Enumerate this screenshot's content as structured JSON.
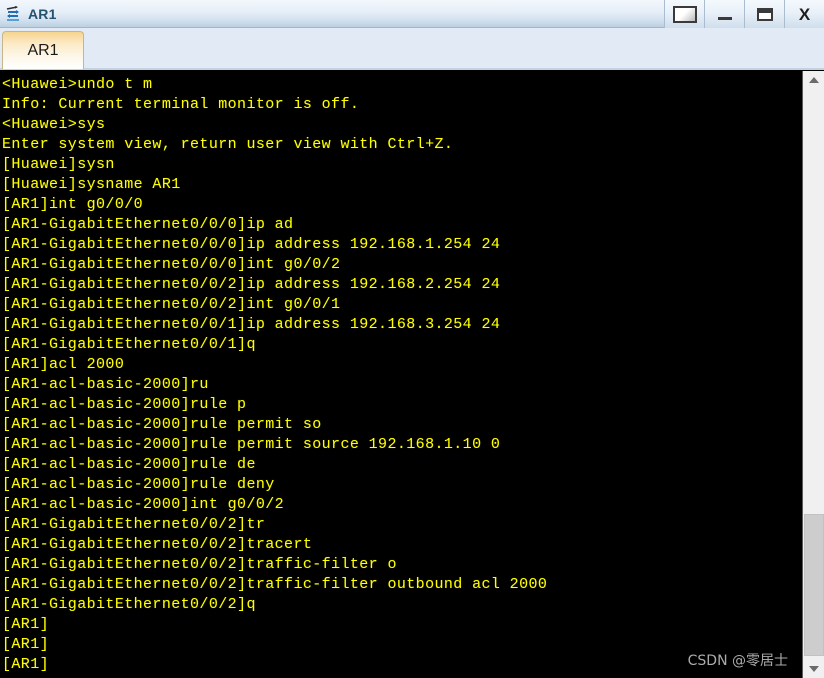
{
  "window": {
    "title": "AR1",
    "icon": "router-icon",
    "buttons": [
      {
        "name": "restore-button",
        "label": "Restore",
        "glyph": "restore-icon"
      },
      {
        "name": "minimize-button",
        "label": "Minimize",
        "glyph": "minimize-icon"
      },
      {
        "name": "maximize-button",
        "label": "Maximize",
        "glyph": "maximize-icon"
      },
      {
        "name": "close-button",
        "label": "X",
        "glyph": "close-icon"
      }
    ]
  },
  "tabs": [
    {
      "label": "AR1",
      "active": true
    }
  ],
  "terminal": {
    "background_color": "#000000",
    "text_color": "#ffff00",
    "lines": [
      "<Huawei>undo t m",
      "Info: Current terminal monitor is off.",
      "<Huawei>sys",
      "Enter system view, return user view with Ctrl+Z.",
      "[Huawei]sysn",
      "[Huawei]sysname AR1",
      "[AR1]int g0/0/0",
      "[AR1-GigabitEthernet0/0/0]ip ad",
      "[AR1-GigabitEthernet0/0/0]ip address 192.168.1.254 24",
      "[AR1-GigabitEthernet0/0/0]int g0/0/2",
      "[AR1-GigabitEthernet0/0/2]ip address 192.168.2.254 24",
      "[AR1-GigabitEthernet0/0/2]int g0/0/1",
      "[AR1-GigabitEthernet0/0/1]ip address 192.168.3.254 24",
      "[AR1-GigabitEthernet0/0/1]q",
      "[AR1]acl 2000",
      "[AR1-acl-basic-2000]ru",
      "[AR1-acl-basic-2000]rule p",
      "[AR1-acl-basic-2000]rule permit so",
      "[AR1-acl-basic-2000]rule permit source 192.168.1.10 0",
      "[AR1-acl-basic-2000]rule de",
      "[AR1-acl-basic-2000]rule deny",
      "[AR1-acl-basic-2000]int g0/0/2",
      "[AR1-GigabitEthernet0/0/2]tr",
      "[AR1-GigabitEthernet0/0/2]tracert",
      "[AR1-GigabitEthernet0/0/2]traffic-filter o",
      "[AR1-GigabitEthernet0/0/2]traffic-filter outbound acl 2000",
      "[AR1-GigabitEthernet0/0/2]q",
      "[AR1]",
      "[AR1]",
      "[AR1]"
    ]
  },
  "watermark": {
    "text": "CSDN @零居士"
  },
  "scrollbar": {
    "up_arrow": "chevron-up-icon",
    "down_arrow": "chevron-down-icon"
  }
}
